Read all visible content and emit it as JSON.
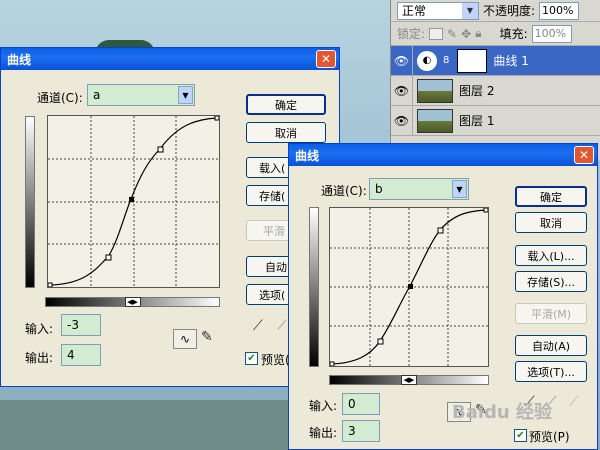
{
  "layers_panel": {
    "blend_mode": "正常",
    "opacity_label": "不透明度:",
    "opacity_value": "100%",
    "lock_label": "锁定:",
    "fill_label": "填充:",
    "fill_value": "100%",
    "layers": [
      {
        "name": "曲线 1",
        "selected": true
      },
      {
        "name": "图层 2",
        "selected": false
      },
      {
        "name": "图层 1",
        "selected": false
      }
    ]
  },
  "dialog1": {
    "title": "曲线",
    "channel_label": "通道(C):",
    "channel_value": "a",
    "ok": "确定",
    "cancel": "取消",
    "load": "载入(",
    "save": "存储(",
    "smooth": "平滑",
    "auto": "自动",
    "options": "选项(",
    "input_label": "输入:",
    "input_value": "-3",
    "output_label": "输出:",
    "output_value": "4",
    "preview_label": "预览("
  },
  "dialog2": {
    "title": "曲线",
    "channel_label": "通道(C):",
    "channel_value": "b",
    "ok": "确定",
    "cancel": "取消",
    "load": "载入(L)...",
    "save": "存储(S)...",
    "smooth": "平滑(M)",
    "auto": "自动(A)",
    "options": "选项(T)...",
    "input_label": "输入:",
    "input_value": "0",
    "output_label": "输出:",
    "output_value": "3",
    "preview_label": "预览(P)"
  },
  "watermark": "Baidu 经验"
}
